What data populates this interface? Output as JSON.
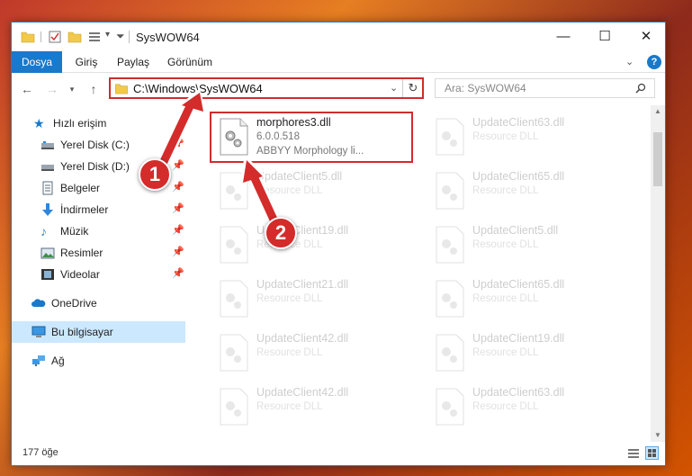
{
  "window": {
    "title": "SysWOW64"
  },
  "titlebar": {
    "minimize": "—",
    "maximize": "☐",
    "close": "✕"
  },
  "ribbon": {
    "tabs": [
      "Dosya",
      "Giriş",
      "Paylaş",
      "Görünüm"
    ],
    "help": "?"
  },
  "address": {
    "path": "C:\\Windows\\SysWOW64"
  },
  "search": {
    "placeholder": "Ara: SysWOW64"
  },
  "sidebar": {
    "quick_access": "Hızlı erişim",
    "items": [
      {
        "label": "Yerel Disk (C:)",
        "icon": "drive-icon",
        "pinned": true
      },
      {
        "label": "Yerel Disk (D:)",
        "icon": "drive-icon",
        "pinned": true
      },
      {
        "label": "Belgeler",
        "icon": "documents-icon",
        "pinned": true
      },
      {
        "label": "İndirmeler",
        "icon": "downloads-icon",
        "pinned": true
      },
      {
        "label": "Müzik",
        "icon": "music-icon",
        "pinned": true
      },
      {
        "label": "Resimler",
        "icon": "pictures-icon",
        "pinned": true
      },
      {
        "label": "Videolar",
        "icon": "videos-icon",
        "pinned": true
      }
    ],
    "onedrive": "OneDrive",
    "this_pc": "Bu bilgisayar",
    "network": "Ağ"
  },
  "files": {
    "main": {
      "name": "morphores3.dll",
      "version": "6.0.0.518",
      "description": "ABBYY Morphology li..."
    },
    "faded": [
      {
        "name": "UpdateClient63.dll",
        "type": "Resource DLL"
      },
      {
        "name": "UpdateClient5.dll",
        "type": "Resource DLL"
      },
      {
        "name": "UpdateClient65.dll",
        "type": "Resource DLL"
      },
      {
        "name": "UpdateClient19.dll",
        "type": "Resource DLL"
      },
      {
        "name": "UpdateClient5.dll",
        "type": "Resource DLL"
      },
      {
        "name": "UpdateClient21.dll",
        "type": "Resource DLL"
      },
      {
        "name": "UpdateClient65.dll",
        "type": "Resource DLL"
      },
      {
        "name": "UpdateClient42.dll",
        "type": "Resource DLL"
      },
      {
        "name": "UpdateClient19.dll",
        "type": "Resource DLL"
      },
      {
        "name": "UpdateClient42.dll",
        "type": "Resource DLL"
      },
      {
        "name": "UpdateClient63.dll",
        "type": "Resource DLL"
      }
    ]
  },
  "status": {
    "count": "177 öğe"
  },
  "callouts": [
    "1",
    "2"
  ],
  "colors": {
    "accent": "#1979ca",
    "highlight": "#d42b2b",
    "selection": "#cce8ff"
  }
}
